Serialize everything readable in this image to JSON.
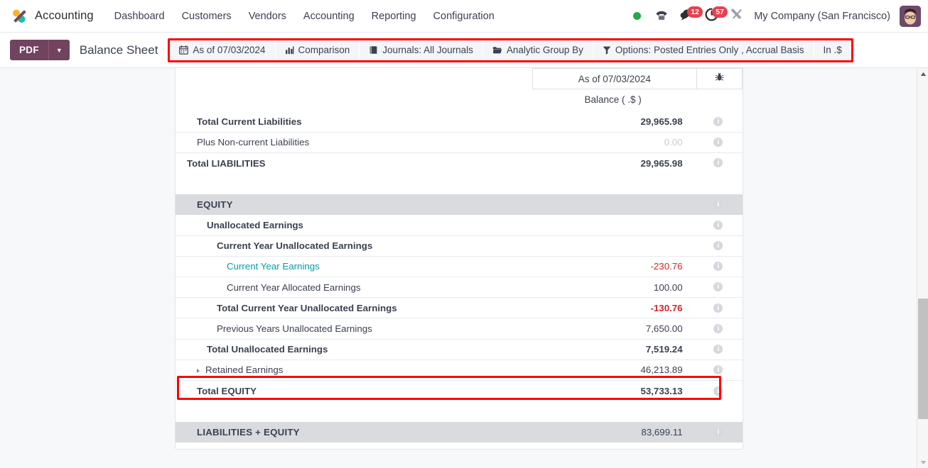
{
  "navbar": {
    "brand": "Accounting",
    "menu": [
      {
        "label": "Dashboard"
      },
      {
        "label": "Customers"
      },
      {
        "label": "Vendors"
      },
      {
        "label": "Accounting"
      },
      {
        "label": "Reporting"
      },
      {
        "label": "Configuration"
      }
    ],
    "messages_count": "12",
    "activities_count": "57",
    "company": "My Company (San Francisco)"
  },
  "controlbar": {
    "pdf_label": "PDF",
    "report_title": "Balance Sheet",
    "filters": [
      {
        "label": "As of 07/03/2024",
        "icon": "calendar-icon"
      },
      {
        "label": "Comparison",
        "icon": "bar-chart-icon"
      },
      {
        "label": "Journals: All Journals",
        "icon": "book-icon"
      },
      {
        "label": "Analytic Group By",
        "icon": "folder-icon"
      },
      {
        "label": "Options: Posted Entries Only , Accrual Basis",
        "icon": "funnel-icon"
      },
      {
        "label": "In .$",
        "icon": "none"
      }
    ]
  },
  "report": {
    "column_header_date": "As of 07/03/2024",
    "balance_label": "Balance ( .$ )",
    "rows": [
      {
        "name": "Total Current Liabilities",
        "value": "29,965.98",
        "indent": 1,
        "bold": true,
        "style": "clipped"
      },
      {
        "name": "Plus Non-current Liabilities",
        "value": "0.00",
        "indent": 1,
        "bold": false,
        "style": "muted"
      },
      {
        "name": "Total LIABILITIES",
        "value": "29,965.98",
        "indent": 0,
        "bold": true,
        "style": "normal"
      },
      {
        "name": "EQUITY",
        "value": "",
        "indent": 0,
        "bold": true,
        "style": "section"
      },
      {
        "name": "Unallocated Earnings",
        "value": "",
        "indent": 1,
        "bold": true,
        "style": "normal"
      },
      {
        "name": "Current Year Unallocated Earnings",
        "value": "",
        "indent": 2,
        "bold": true,
        "style": "normal"
      },
      {
        "name": "Current Year Earnings",
        "value": "-230.76",
        "indent": 3,
        "bold": false,
        "style": "link-negative"
      },
      {
        "name": "Current Year Allocated Earnings",
        "value": "100.00",
        "indent": 3,
        "bold": false,
        "style": "normal"
      },
      {
        "name": "Total Current Year Unallocated Earnings",
        "value": "-130.76",
        "indent": 2,
        "bold": true,
        "style": "negative"
      },
      {
        "name": "Previous Years Unallocated Earnings",
        "value": "7,650.00",
        "indent": 2,
        "bold": false,
        "style": "highlighted"
      },
      {
        "name": "Total Unallocated Earnings",
        "value": "7,519.24",
        "indent": 1,
        "bold": true,
        "style": "normal"
      },
      {
        "name": "Retained Earnings",
        "value": "46,213.89",
        "indent": 1,
        "bold": false,
        "style": "expandable"
      },
      {
        "name": "Total EQUITY",
        "value": "53,733.13",
        "indent": 0,
        "bold": true,
        "style": "normal"
      },
      {
        "name": "LIABILITIES + EQUITY",
        "value": "83,699.11",
        "indent": 0,
        "bold": true,
        "style": "section"
      }
    ]
  },
  "colors": {
    "brand_purple": "#71435f",
    "highlight_red": "#ff0000",
    "negative_red": "#d4242c",
    "link_teal": "#00a09d",
    "badge_red": "#e6404e",
    "section_grey": "#d9dbdf"
  }
}
